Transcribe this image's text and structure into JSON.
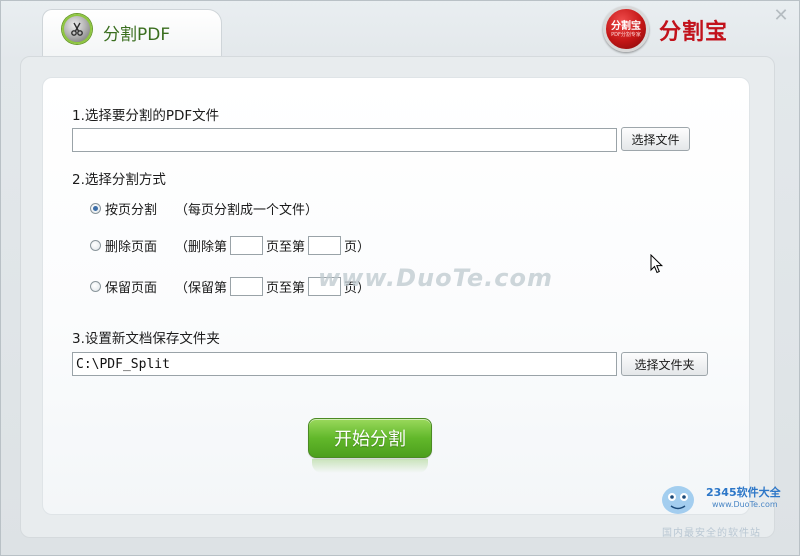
{
  "header": {
    "tab_label": "分割PDF",
    "brand_logo_text": "分割宝",
    "brand_logo_subtext": "PDF分割专家",
    "brand_name": "分割宝",
    "close_symbol": "✕"
  },
  "section1": {
    "label": "1.选择要分割的PDF文件",
    "file_input_value": "",
    "choose_file_button": "选择文件"
  },
  "section2": {
    "label": "2.选择分割方式",
    "options": [
      {
        "label": "按页分割",
        "hint": "（每页分割成一个文件）",
        "checked": true
      },
      {
        "label": "删除页面",
        "prefix": "（删除第",
        "middle": "页至第",
        "suffix": "页）",
        "checked": false
      },
      {
        "label": "保留页面",
        "prefix": "（保留第",
        "middle": "页至第",
        "suffix": "页）",
        "checked": false
      }
    ]
  },
  "section3": {
    "label": "3.设置新文档保存文件夹",
    "folder_input_value": "C:\\PDF_Split",
    "choose_folder_button": "选择文件夹"
  },
  "start_button": "开始分割",
  "watermark": "www.DuoTe.com",
  "corner": {
    "brand": "2345软件大全",
    "url": "www.DuoTe.com",
    "slogan": "国内最安全的软件站"
  },
  "colors": {
    "accent_green": "#62b82b",
    "brand_red": "#c2121b",
    "radio_dot": "#3c6ea8"
  }
}
